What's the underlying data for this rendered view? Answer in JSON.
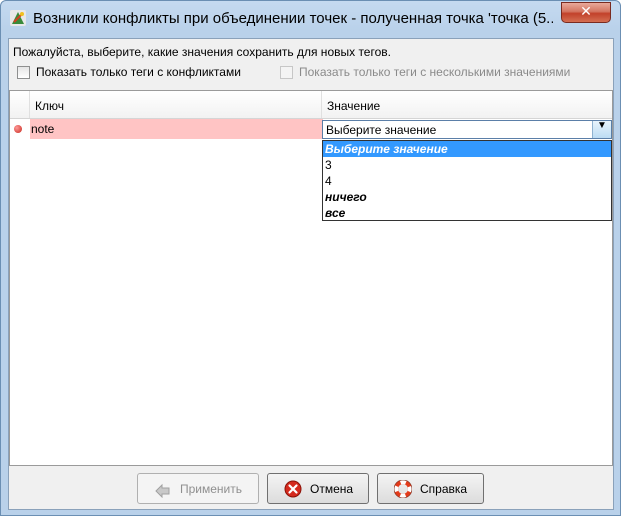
{
  "window": {
    "title": "Возникли конфликты при объединении точек - полученная точка 'точка (5...",
    "close_label": "✕"
  },
  "dialog": {
    "instruction": "Пожалуйста, выберите, какие значения сохранить для новых тегов.",
    "checkbox_conflicts_label": "Показать только теги с конфликтами",
    "checkbox_multi_label": "Показать только теги с несколькими значениями"
  },
  "table": {
    "headers": {
      "key": "Ключ",
      "value": "Значение"
    },
    "row": {
      "key": "note",
      "value": "Выберите значение"
    }
  },
  "dropdown": {
    "options": [
      "Выберите значение",
      "3",
      "4",
      "ничего",
      "все"
    ],
    "selected_index": 0
  },
  "buttons": {
    "apply": "Применить",
    "cancel": "Отмена",
    "help": "Справка"
  },
  "colors": {
    "conflict_row": "#ffc4c4",
    "selection": "#3399ff"
  }
}
